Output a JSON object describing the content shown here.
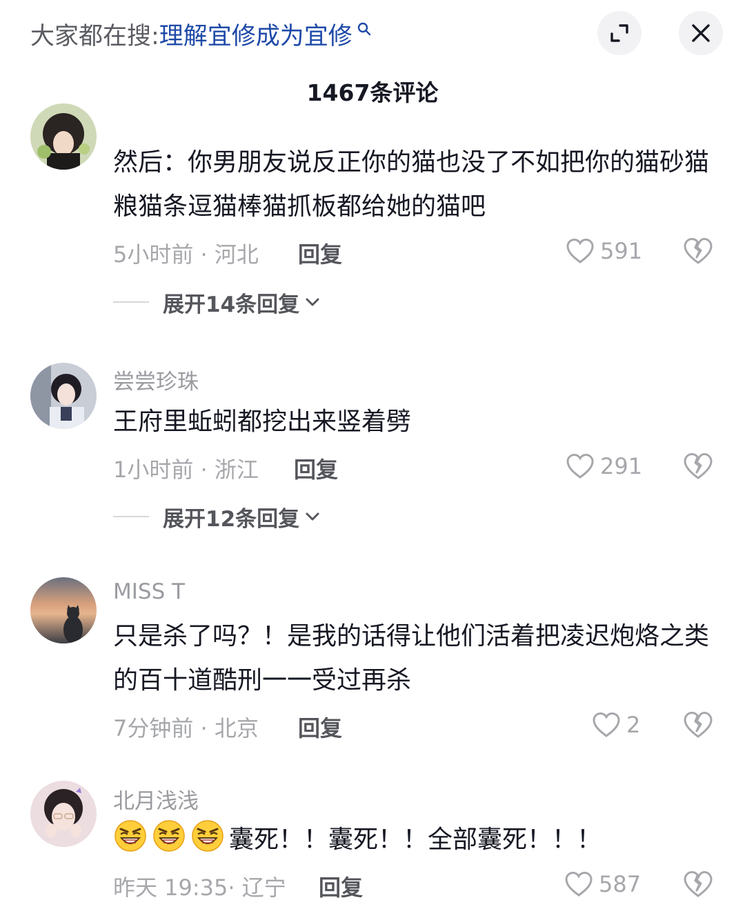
{
  "header": {
    "search_prefix": "大家都在搜:",
    "search_term": "理解宜修成为宜修",
    "comment_count_title": "1467条评论"
  },
  "comments": [
    {
      "username": "",
      "text": "然后：你男朋友说反正你的猫也没了不如把你的猫砂猫粮猫条逗猫棒猫抓板都给她的猫吧",
      "meta": "5小时前 · 河北",
      "reply_label": "回复",
      "likes": "591",
      "expand_label": "展开14条回复"
    },
    {
      "username": "尝尝珍珠",
      "text": "王府里蚯蚓都挖出来竖着劈",
      "meta": "1小时前 · 浙江",
      "reply_label": "回复",
      "likes": "291",
      "expand_label": "展开12条回复"
    },
    {
      "username": "MISS T",
      "text": "只是杀了吗？！是我的话得让他们活着把凌迟炮烙之类的百十道酷刑一一受过再杀",
      "meta": "7分钟前 · 北京",
      "reply_label": "回复",
      "likes": "2"
    },
    {
      "username": "北月浅浅",
      "text": "囊死！！囊死！！全部囊死！！！",
      "meta": "昨天 19:35· 辽宁",
      "reply_label": "回复",
      "likes": "587"
    }
  ],
  "icons": {
    "search": "search-icon",
    "expand": "expand-icon",
    "close": "close-icon",
    "like": "heart-icon",
    "dislike": "broken-heart-icon",
    "chevron": "chevron-down-icon",
    "emoji": "angry-laugh-emoji"
  },
  "colors": {
    "search_term": "#1f4aa8",
    "muted_text": "#a6a7ab",
    "primary_text": "#161823"
  }
}
